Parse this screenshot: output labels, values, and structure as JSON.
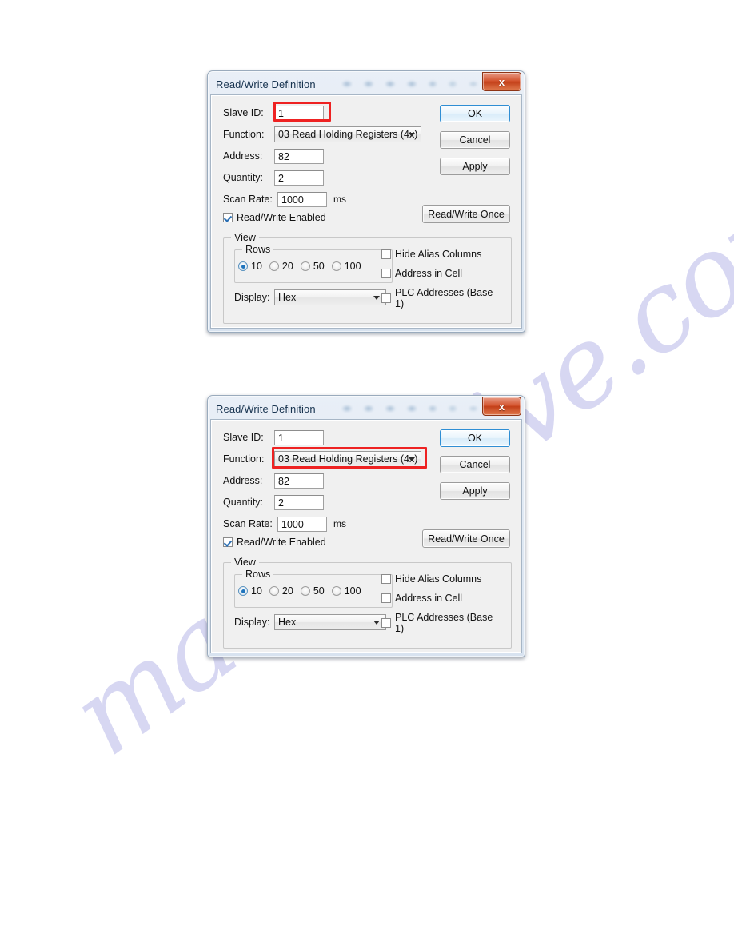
{
  "page": {
    "watermark_text": "manualslive.com"
  },
  "dialogs": [
    {
      "title": "Read/Write Definition",
      "close_label": "x",
      "close_icon": "close-icon",
      "highlight_target": "slave-id",
      "highlight_color": "#ee2222",
      "fields": {
        "slave_id_label": "Slave ID:",
        "slave_id_value": "1",
        "function_label": "Function:",
        "function_value": "03 Read Holding Registers (4x)",
        "address_label": "Address:",
        "address_value": "82",
        "quantity_label": "Quantity:",
        "quantity_value": "2",
        "scan_rate_label": "Scan Rate:",
        "scan_rate_value": "1000",
        "scan_rate_unit": "ms",
        "read_write_enabled_label": "Read/Write Enabled",
        "read_write_enabled_checked": true
      },
      "buttons": {
        "ok": "OK",
        "cancel": "Cancel",
        "apply": "Apply",
        "read_write_once": "Read/Write Once"
      },
      "view": {
        "group_label": "View",
        "rows_group_label": "Rows",
        "rows_options": [
          "10",
          "20",
          "50",
          "100"
        ],
        "rows_selected": "10",
        "display_label": "Display:",
        "display_value": "Hex",
        "checkboxes": [
          {
            "label": "Hide Alias Columns",
            "checked": false
          },
          {
            "label": "Address in Cell",
            "checked": false
          },
          {
            "label": "PLC Addresses (Base 1)",
            "checked": false
          }
        ]
      }
    },
    {
      "title": "Read/Write Definition",
      "close_label": "x",
      "close_icon": "close-icon",
      "highlight_target": "function",
      "highlight_color": "#ee2222",
      "fields": {
        "slave_id_label": "Slave ID:",
        "slave_id_value": "1",
        "function_label": "Function:",
        "function_value": "03 Read Holding Registers (4x)",
        "address_label": "Address:",
        "address_value": "82",
        "quantity_label": "Quantity:",
        "quantity_value": "2",
        "scan_rate_label": "Scan Rate:",
        "scan_rate_value": "1000",
        "scan_rate_unit": "ms",
        "read_write_enabled_label": "Read/Write Enabled",
        "read_write_enabled_checked": true
      },
      "buttons": {
        "ok": "OK",
        "cancel": "Cancel",
        "apply": "Apply",
        "read_write_once": "Read/Write Once"
      },
      "view": {
        "group_label": "View",
        "rows_group_label": "Rows",
        "rows_options": [
          "10",
          "20",
          "50",
          "100"
        ],
        "rows_selected": "10",
        "display_label": "Display:",
        "display_value": "Hex",
        "checkboxes": [
          {
            "label": "Hide Alias Columns",
            "checked": false
          },
          {
            "label": "Address in Cell",
            "checked": false
          },
          {
            "label": "PLC Addresses (Base 1)",
            "checked": false
          }
        ]
      }
    }
  ]
}
